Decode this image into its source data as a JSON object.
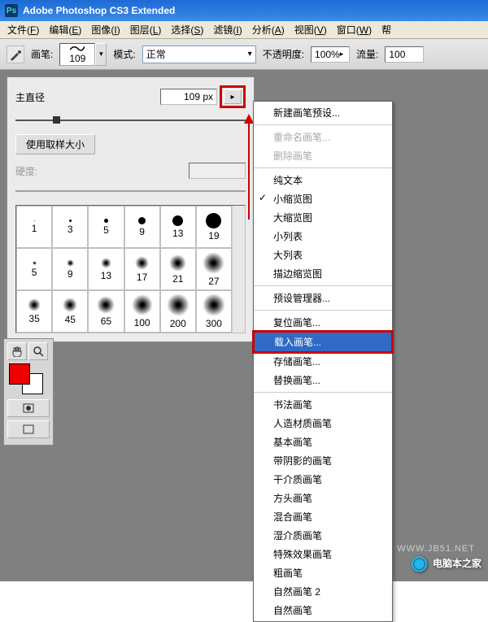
{
  "window": {
    "title": "Adobe Photoshop CS3 Extended",
    "icon_label": "Ps"
  },
  "menubar": {
    "items": [
      {
        "label": "文件",
        "ul": "F"
      },
      {
        "label": "编辑",
        "ul": "E"
      },
      {
        "label": "图像",
        "ul": "I"
      },
      {
        "label": "图层",
        "ul": "L"
      },
      {
        "label": "选择",
        "ul": "S"
      },
      {
        "label": "滤镜",
        "ul": "I"
      },
      {
        "label": "分析",
        "ul": "A"
      },
      {
        "label": "视图",
        "ul": "V"
      },
      {
        "label": "窗口",
        "ul": "W"
      },
      {
        "label": "帮"
      }
    ]
  },
  "options": {
    "brush_label": "画笔:",
    "brush_size": "109",
    "mode_label": "模式:",
    "mode_value": "正常",
    "opacity_label": "不透明度:",
    "opacity_value": "100%",
    "flow_label": "流量:",
    "flow_value": "100"
  },
  "brush_panel": {
    "diameter_label": "主直径",
    "diameter_value": "109 px",
    "use_sample": "使用取样大小",
    "hardness_label": "硬度:",
    "grid": [
      {
        "size": 1,
        "label": "1",
        "type": "dot"
      },
      {
        "size": 3,
        "label": "3",
        "type": "dot"
      },
      {
        "size": 5,
        "label": "5",
        "type": "dot"
      },
      {
        "size": 9,
        "label": "9",
        "type": "dot"
      },
      {
        "size": 13,
        "label": "13",
        "type": "dot"
      },
      {
        "size": 19,
        "label": "19",
        "type": "dot"
      },
      {
        "size": 5,
        "label": "5",
        "type": "soft"
      },
      {
        "size": 9,
        "label": "9",
        "type": "soft"
      },
      {
        "size": 13,
        "label": "13",
        "type": "soft"
      },
      {
        "size": 17,
        "label": "17",
        "type": "soft"
      },
      {
        "size": 21,
        "label": "21",
        "type": "soft"
      },
      {
        "size": 27,
        "label": "27",
        "type": "soft"
      },
      {
        "size": 16,
        "label": "35",
        "type": "soft"
      },
      {
        "size": 18,
        "label": "45",
        "type": "soft"
      },
      {
        "size": 22,
        "label": "65",
        "type": "soft"
      },
      {
        "size": 26,
        "label": "100",
        "type": "soft"
      },
      {
        "size": 30,
        "label": "200",
        "type": "soft"
      },
      {
        "size": 34,
        "label": "300",
        "type": "soft"
      }
    ],
    "extra_row": [
      {
        "label": "9",
        "type": "dot",
        "size": 10
      },
      {
        "label": "13",
        "type": "dot",
        "size": 13
      },
      {
        "label": "19",
        "type": "dot",
        "size": 17
      },
      {
        "label": "17",
        "type": "dot",
        "size": 15
      },
      {
        "label": "45",
        "type": "soft",
        "size": 24
      },
      {
        "label": "65",
        "type": "soft",
        "size": 28
      }
    ]
  },
  "ctx_menu": {
    "groups": [
      [
        {
          "label": "新建画笔预设..."
        }
      ],
      [
        {
          "label": "重命名画笔...",
          "disabled": true
        },
        {
          "label": "删除画笔",
          "disabled": true
        }
      ],
      [
        {
          "label": "纯文本"
        },
        {
          "label": "小缩览图",
          "checked": true
        },
        {
          "label": "大缩览图"
        },
        {
          "label": "小列表"
        },
        {
          "label": "大列表"
        },
        {
          "label": "描边缩览图"
        }
      ],
      [
        {
          "label": "预设管理器..."
        }
      ],
      [
        {
          "label": "复位画笔..."
        },
        {
          "label": "载入画笔...",
          "selected": true,
          "highlighted": true
        },
        {
          "label": "存储画笔..."
        },
        {
          "label": "替换画笔..."
        }
      ],
      [
        {
          "label": "书法画笔"
        },
        {
          "label": "人造材质画笔"
        },
        {
          "label": "基本画笔"
        },
        {
          "label": "带阴影的画笔"
        },
        {
          "label": "干介质画笔"
        },
        {
          "label": "方头画笔"
        },
        {
          "label": "混合画笔"
        },
        {
          "label": "湿介质画笔"
        },
        {
          "label": "特殊效果画笔"
        },
        {
          "label": "粗画笔"
        },
        {
          "label": "自然画笔 2"
        },
        {
          "label": "自然画笔"
        }
      ]
    ]
  },
  "watermark": {
    "text": "电脑本之家",
    "sub": "WWW.JB51.NET"
  }
}
